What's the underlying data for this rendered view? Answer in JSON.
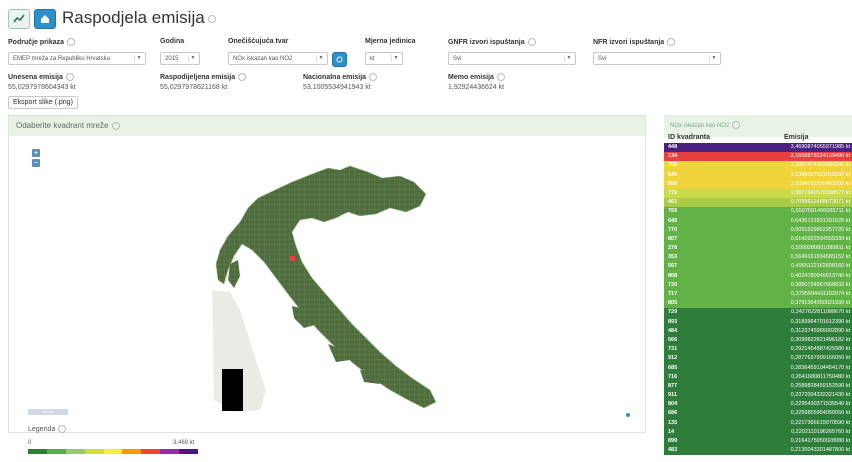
{
  "page": {
    "title": "Raspodjela emisija"
  },
  "filters": [
    {
      "label": "Područje prikaza",
      "value": "EMEP mreža za Republiku Hrvatsku"
    },
    {
      "label": "Godina",
      "value": "2015"
    },
    {
      "label": "Onečišćujuća tvar",
      "value": "NOx iskazan kao NO2"
    },
    {
      "label": "Mjerna jedinica",
      "value": "kt"
    },
    {
      "label": "GNFR izvori ispuštanja",
      "value": "Svi"
    },
    {
      "label": "NFR izvori ispuštanja",
      "value": "Svi"
    }
  ],
  "stats": [
    {
      "label": "Unesena emisija",
      "value": "55,0297978604343 kt"
    },
    {
      "label": "Raspodijeljena emisija",
      "value": "55,0297978621168 kt"
    },
    {
      "label": "Nacionalna emisija",
      "value": "53,1005534941943 kt"
    },
    {
      "label": "Memo emisija",
      "value": "1,92924436624 kt"
    }
  ],
  "export_label": "Eksport slike (.png)",
  "map": {
    "header": "Odaberite kvadrant mreže",
    "zoom_in": "+",
    "zoom_out": "−",
    "reset_label": "Reset"
  },
  "legend": {
    "title": "Legenda",
    "min": "0",
    "max": "3,469 kt",
    "colors": [
      "#2e7d32",
      "#4caf50",
      "#9ccc65",
      "#cddc39",
      "#ffeb3b",
      "#ff9800",
      "#f44336",
      "#9c27b0",
      "#4a148c"
    ]
  },
  "table": {
    "title": "NOx iskazan kao NO2",
    "col_id": "ID kvadranta",
    "col_em": "Emisija",
    "rows": [
      {
        "id": "448",
        "em": "3,4690874055971985 kt",
        "color": "#4a2080"
      },
      {
        "id": "134",
        "em": "2,1698879224109490 kt",
        "color": "#e8403e"
      },
      {
        "id": "700",
        "em": "1,2997474952889245 kt",
        "color": "#f0d43c"
      },
      {
        "id": "645",
        "em": "1,1386097821010632 kt",
        "color": "#f0d43c"
      },
      {
        "id": "806",
        "em": "1,0094792530403205 kt",
        "color": "#f0d43c"
      },
      {
        "id": "771",
        "em": "1,0077840576598577 kt",
        "color": "#c9db4a"
      },
      {
        "id": "461",
        "em": "0,7058612488673071 kt",
        "color": "#aacb46"
      },
      {
        "id": "769",
        "em": "0,6507581466685711 kt",
        "color": "#63b248"
      },
      {
        "id": "645",
        "em": "0,6435131831201625 kt",
        "color": "#63b248"
      },
      {
        "id": "770",
        "em": "0,6051529862257720 kt",
        "color": "#63b248"
      },
      {
        "id": "807",
        "em": "0,6142922934555339 kt",
        "color": "#63b248"
      },
      {
        "id": "278",
        "em": "0,5999280801080811 kt",
        "color": "#63b248"
      },
      {
        "id": "353",
        "em": "0,5649161934585152 kt",
        "color": "#63b248"
      },
      {
        "id": "567",
        "em": "0,4965112162608160 kt",
        "color": "#63b248"
      },
      {
        "id": "808",
        "em": "0,4024780945613740 kt",
        "color": "#63b248"
      },
      {
        "id": "730",
        "em": "0,3850734967668832 kt",
        "color": "#63b248"
      },
      {
        "id": "717",
        "em": "0,3795504431182074 kt",
        "color": "#63b248"
      },
      {
        "id": "805",
        "em": "0,3791364350021930 kt",
        "color": "#63b248"
      },
      {
        "id": "729",
        "em": "0,3427622811088670 kt",
        "color": "#2f7d3a"
      },
      {
        "id": "893",
        "em": "0,3183964701612390 kt",
        "color": "#2f7d3a"
      },
      {
        "id": "484",
        "em": "0,3123745965002890 kt",
        "color": "#2f7d3a"
      },
      {
        "id": "566",
        "em": "0,3099822821496182 kt",
        "color": "#2f7d3a"
      },
      {
        "id": "731",
        "em": "0,2921454887425980 kt",
        "color": "#2f7d3a"
      },
      {
        "id": "912",
        "em": "0,2877637909166050 kt",
        "color": "#2f7d3a"
      },
      {
        "id": "685",
        "em": "0,2836459104454170 kt",
        "color": "#2f7d3a"
      },
      {
        "id": "716",
        "em": "0,2641680811750480 kt",
        "color": "#2f7d3a"
      },
      {
        "id": "877",
        "em": "0,2589828459152590 kt",
        "color": "#2f7d3a"
      },
      {
        "id": "911",
        "em": "0,2372004332321430 kt",
        "color": "#2f7d3a"
      },
      {
        "id": "804",
        "em": "0,2295430371535540 kt",
        "color": "#2f7d3a"
      },
      {
        "id": "686",
        "em": "0,2259855954050050 kt",
        "color": "#2f7d3a"
      },
      {
        "id": "135",
        "em": "0,2217366615070590 kt",
        "color": "#2f7d3a"
      },
      {
        "id": "14",
        "em": "0,2202110196265760 kt",
        "color": "#2f7d3a"
      },
      {
        "id": "899",
        "em": "0,2164175950028080 kt",
        "color": "#2f7d3a"
      },
      {
        "id": "483",
        "em": "0,2130043301487800 kt",
        "color": "#2f7d3a"
      }
    ]
  }
}
